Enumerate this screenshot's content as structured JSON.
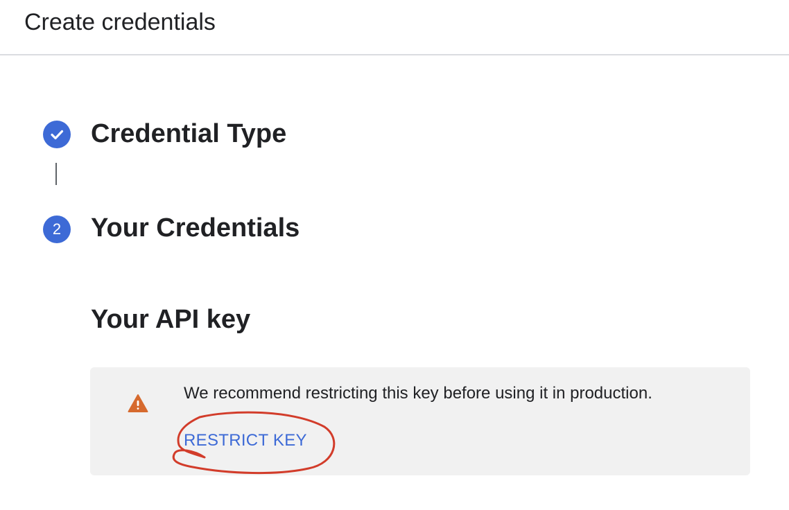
{
  "dialog": {
    "title": "Create credentials"
  },
  "steps": [
    {
      "label": "Credential Type",
      "state": "completed",
      "icon": "check-icon"
    },
    {
      "label": "Your Credentials",
      "state": "active",
      "number": "2"
    }
  ],
  "api_key": {
    "heading": "Your API key",
    "warning": {
      "icon": "warning-icon",
      "message": "We recommend restricting this key before using it in production.",
      "action_label": "RESTRICT KEY"
    }
  },
  "colors": {
    "accent": "#3d6ad6",
    "warning": "#d66a2e",
    "annotation": "#d23c2a",
    "panel": "#f1f1f1"
  }
}
